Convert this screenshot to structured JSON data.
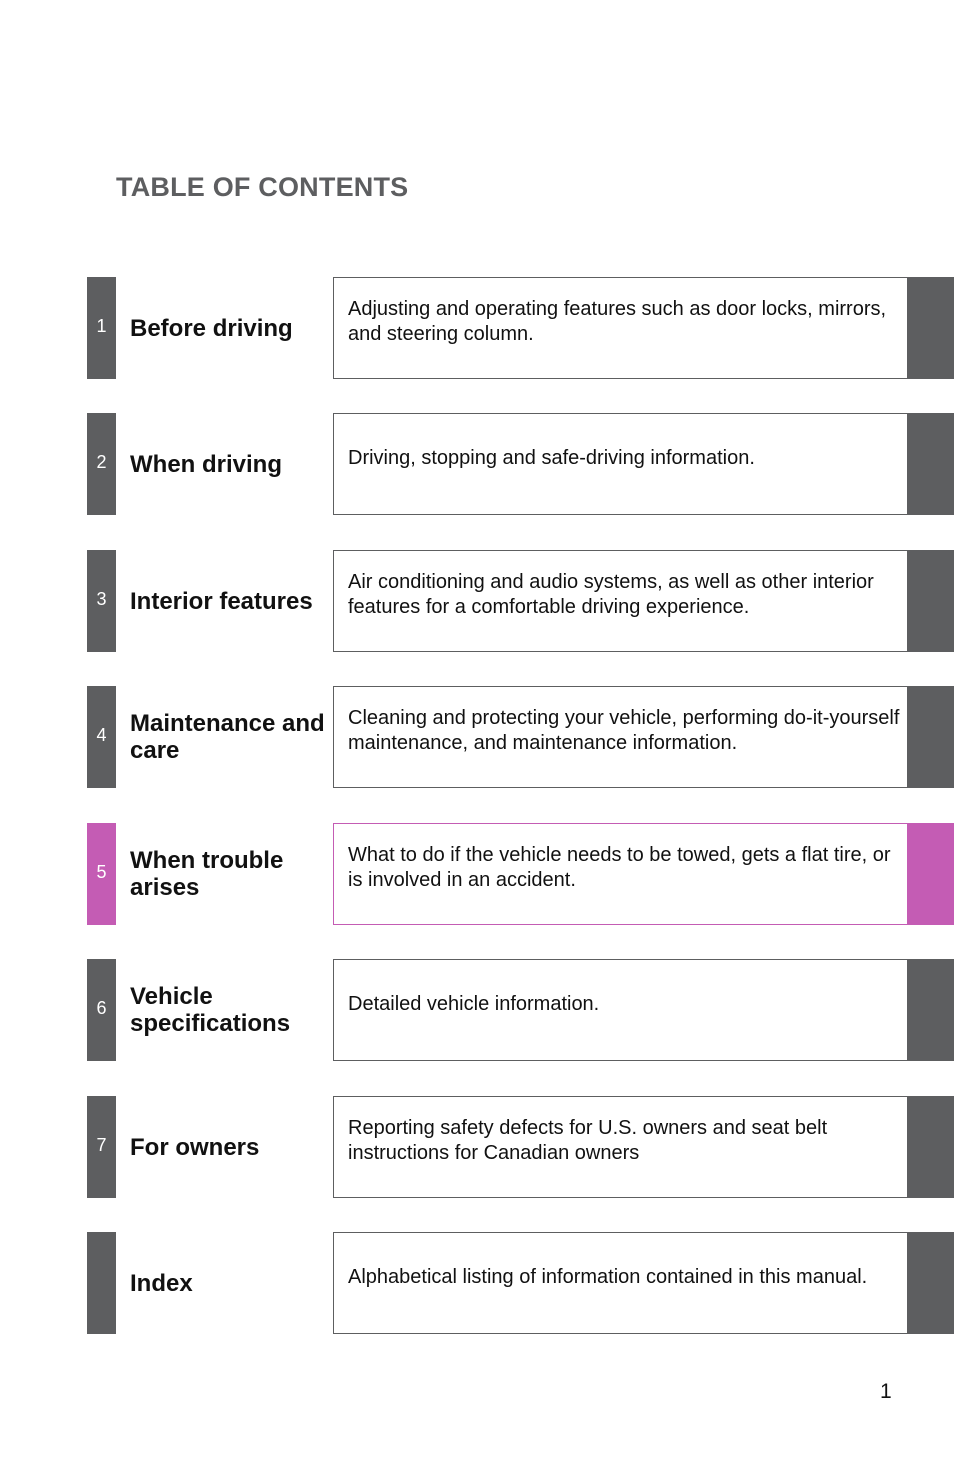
{
  "page": {
    "title": "TABLE OF CONTENTS",
    "page_number": "1",
    "colors": {
      "tab_default": "#5d5e60",
      "tab_active": "#c45cb4"
    }
  },
  "sections": [
    {
      "number": "1",
      "label": "Before driving",
      "description": "Adjusting and operating features such as door locks, mirrors, and steering column.",
      "active": false
    },
    {
      "number": "2",
      "label": "When driving",
      "description": "Driving, stopping and safe-driving information.",
      "active": false
    },
    {
      "number": "3",
      "label": "Interior features",
      "description": "Air conditioning and audio systems, as well as other interior features for a comfortable driving experience.",
      "active": false
    },
    {
      "number": "4",
      "label": "Maintenance and care",
      "description": "Cleaning and protecting your vehicle, performing do-it-yourself maintenance, and maintenance information.",
      "active": false
    },
    {
      "number": "5",
      "label": "When trouble arises",
      "description": "What to do if the vehicle needs to be towed, gets a flat tire, or is involved in an accident.",
      "active": true
    },
    {
      "number": "6",
      "label": "Vehicle specifications",
      "description": "Detailed vehicle information.",
      "active": false
    },
    {
      "number": "7",
      "label": "For owners",
      "description": "Reporting safety defects for U.S. owners and seat belt instructions for Canadian owners",
      "active": false
    },
    {
      "number": "",
      "label": "Index",
      "description": "Alphabetical listing of information contained in this manual.",
      "active": false
    }
  ]
}
